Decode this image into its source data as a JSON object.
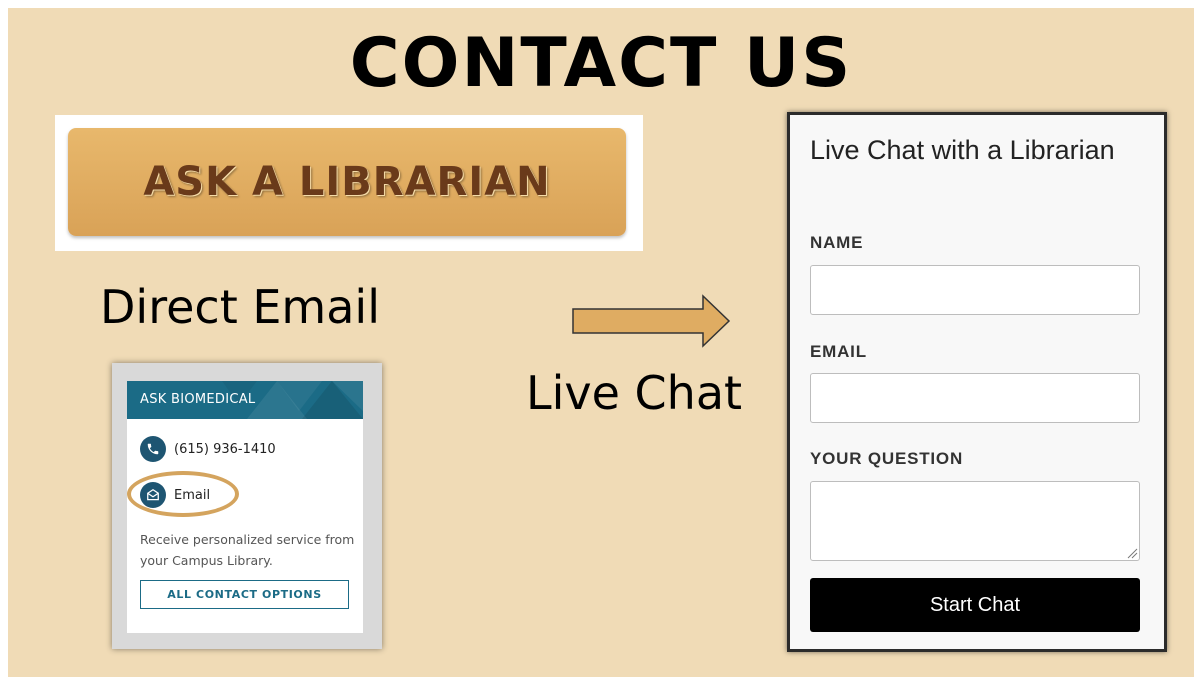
{
  "slide": {
    "title": "CONTACT US",
    "background_color": "#f0dbb6"
  },
  "ask_librarian": {
    "label": "ASK A LIBRARIAN",
    "color": "#dfac62"
  },
  "direct_email": {
    "heading": "Direct Email",
    "widget": {
      "header": "ASK BIOMEDICAL",
      "header_color": "#1b6b86",
      "phone": "(615) 936-1410",
      "phone_icon": "phone-icon",
      "email": "Email",
      "email_icon": "envelope-icon",
      "description": "Receive personalized service from your Campus Library.",
      "all_contact_button": "ALL CONTACT OPTIONS"
    }
  },
  "live_chat": {
    "heading": "Live Chat",
    "arrow_icon": "arrow-right-icon",
    "form": {
      "title": "Live Chat with a Librarian",
      "name_label": "NAME",
      "name_value": "",
      "email_label": "EMAIL",
      "email_value": "",
      "question_label": "YOUR QUESTION",
      "question_value": "",
      "submit_label": "Start Chat"
    }
  }
}
